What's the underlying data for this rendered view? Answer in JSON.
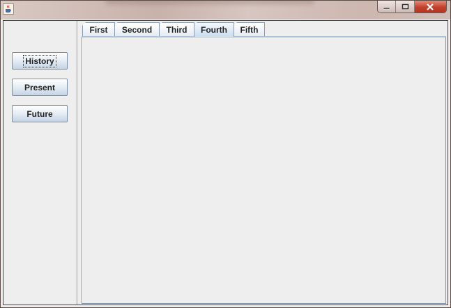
{
  "window": {
    "title": "",
    "controls": {
      "minimize": "minimize",
      "maximize": "maximize",
      "close": "close"
    }
  },
  "sidebar": {
    "buttons": [
      {
        "label": "History",
        "focused": true
      },
      {
        "label": "Present",
        "focused": false
      },
      {
        "label": "Future",
        "focused": false
      }
    ]
  },
  "tabs": {
    "items": [
      {
        "label": "First"
      },
      {
        "label": "Second"
      },
      {
        "label": "Third"
      },
      {
        "label": "Fourth"
      },
      {
        "label": "Fifth"
      }
    ],
    "selected_index": 3
  },
  "colors": {
    "close_button": "#c2412c",
    "selected_tab": "#c9ddf0",
    "panel_background": "#eeeeee"
  }
}
